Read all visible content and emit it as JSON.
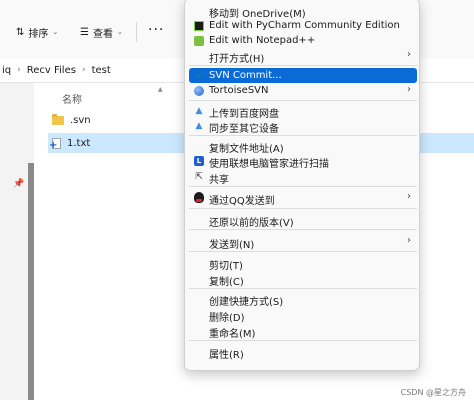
{
  "toolbar": {
    "sort_label": "排序",
    "view_label": "查看",
    "more_label": "···"
  },
  "address": {
    "crumbs": [
      "iq",
      "Recv Files",
      "test"
    ]
  },
  "list": {
    "name_header": "名称",
    "files": [
      {
        "name": ".svn",
        "type": "folder"
      },
      {
        "name": "1.txt",
        "type": "file",
        "selected": true
      }
    ]
  },
  "context_menu": {
    "items": [
      {
        "label": "移动到 OneDrive(M)",
        "icon": ""
      },
      {
        "label": "Edit with PyCharm Community Edition",
        "icon": "pycharm-icon"
      },
      {
        "label": "Edit with Notepad++",
        "icon": "notepadpp-icon"
      },
      {
        "label": "打开方式(H)",
        "icon": "",
        "submenu": true
      },
      {
        "label": "SVN Commit...",
        "icon": "svn-commit-icon",
        "highlighted": true
      },
      {
        "label": "TortoiseSVN",
        "icon": "tortoisesvn-icon",
        "submenu": true
      },
      {
        "label": "上传到百度网盘",
        "icon": "baidu-netdisk-icon"
      },
      {
        "label": "同步至其它设备",
        "icon": "baidu-sync-icon"
      },
      {
        "label": "复制文件地址(A)",
        "icon": ""
      },
      {
        "label": "使用联想电脑管家进行扫描",
        "icon": "lenovo-shield-icon"
      },
      {
        "label": "共享",
        "icon": "share-icon"
      },
      {
        "label": "通过QQ发送到",
        "icon": "qq-icon",
        "submenu": true
      },
      {
        "label": "还原以前的版本(V)",
        "icon": ""
      },
      {
        "label": "发送到(N)",
        "icon": "",
        "submenu": true
      },
      {
        "label": "剪切(T)",
        "icon": ""
      },
      {
        "label": "复制(C)",
        "icon": ""
      },
      {
        "label": "创建快捷方式(S)",
        "icon": ""
      },
      {
        "label": "删除(D)",
        "icon": ""
      },
      {
        "label": "重命名(M)",
        "icon": ""
      },
      {
        "label": "属性(R)",
        "icon": ""
      }
    ]
  },
  "watermark": "CSDN @星之方舟",
  "colors": {
    "menu_highlight": "#0a6ad6",
    "selection": "#cce8ff",
    "folder": "#f0c54b"
  }
}
